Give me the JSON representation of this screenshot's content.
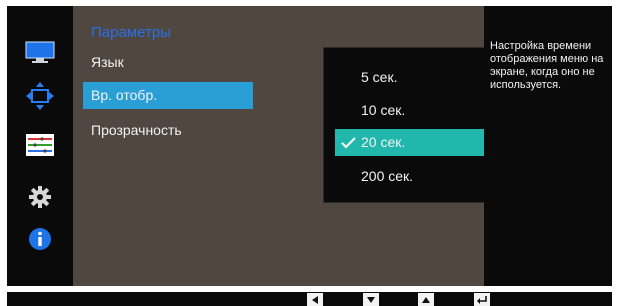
{
  "icons": {
    "strip": [
      "monitor-icon",
      "position-arrows-icon",
      "color-adjust-icon",
      "gear-icon",
      "info-icon"
    ],
    "nav_keys": [
      "left-key-icon",
      "down-key-icon",
      "up-key-icon",
      "enter-key-icon"
    ],
    "check": "checkmark-icon"
  },
  "colors": {
    "title": "#2b6fe6",
    "selected_item": "#2a9fd6",
    "selected_option": "#22b7ad",
    "panel": "#504741"
  },
  "menu": {
    "title": "Параметры",
    "items": [
      {
        "label": "Язык"
      },
      {
        "label": "Вр. отобр."
      },
      {
        "label": "Прозрачность"
      }
    ]
  },
  "submenu": {
    "options": [
      {
        "label": "5 сек."
      },
      {
        "label": "10 сек."
      },
      {
        "label": "20 сек."
      },
      {
        "label": "200 сек."
      }
    ]
  },
  "help": {
    "text": "Настройка времени отображения меню на экране, когда оно не используется."
  }
}
